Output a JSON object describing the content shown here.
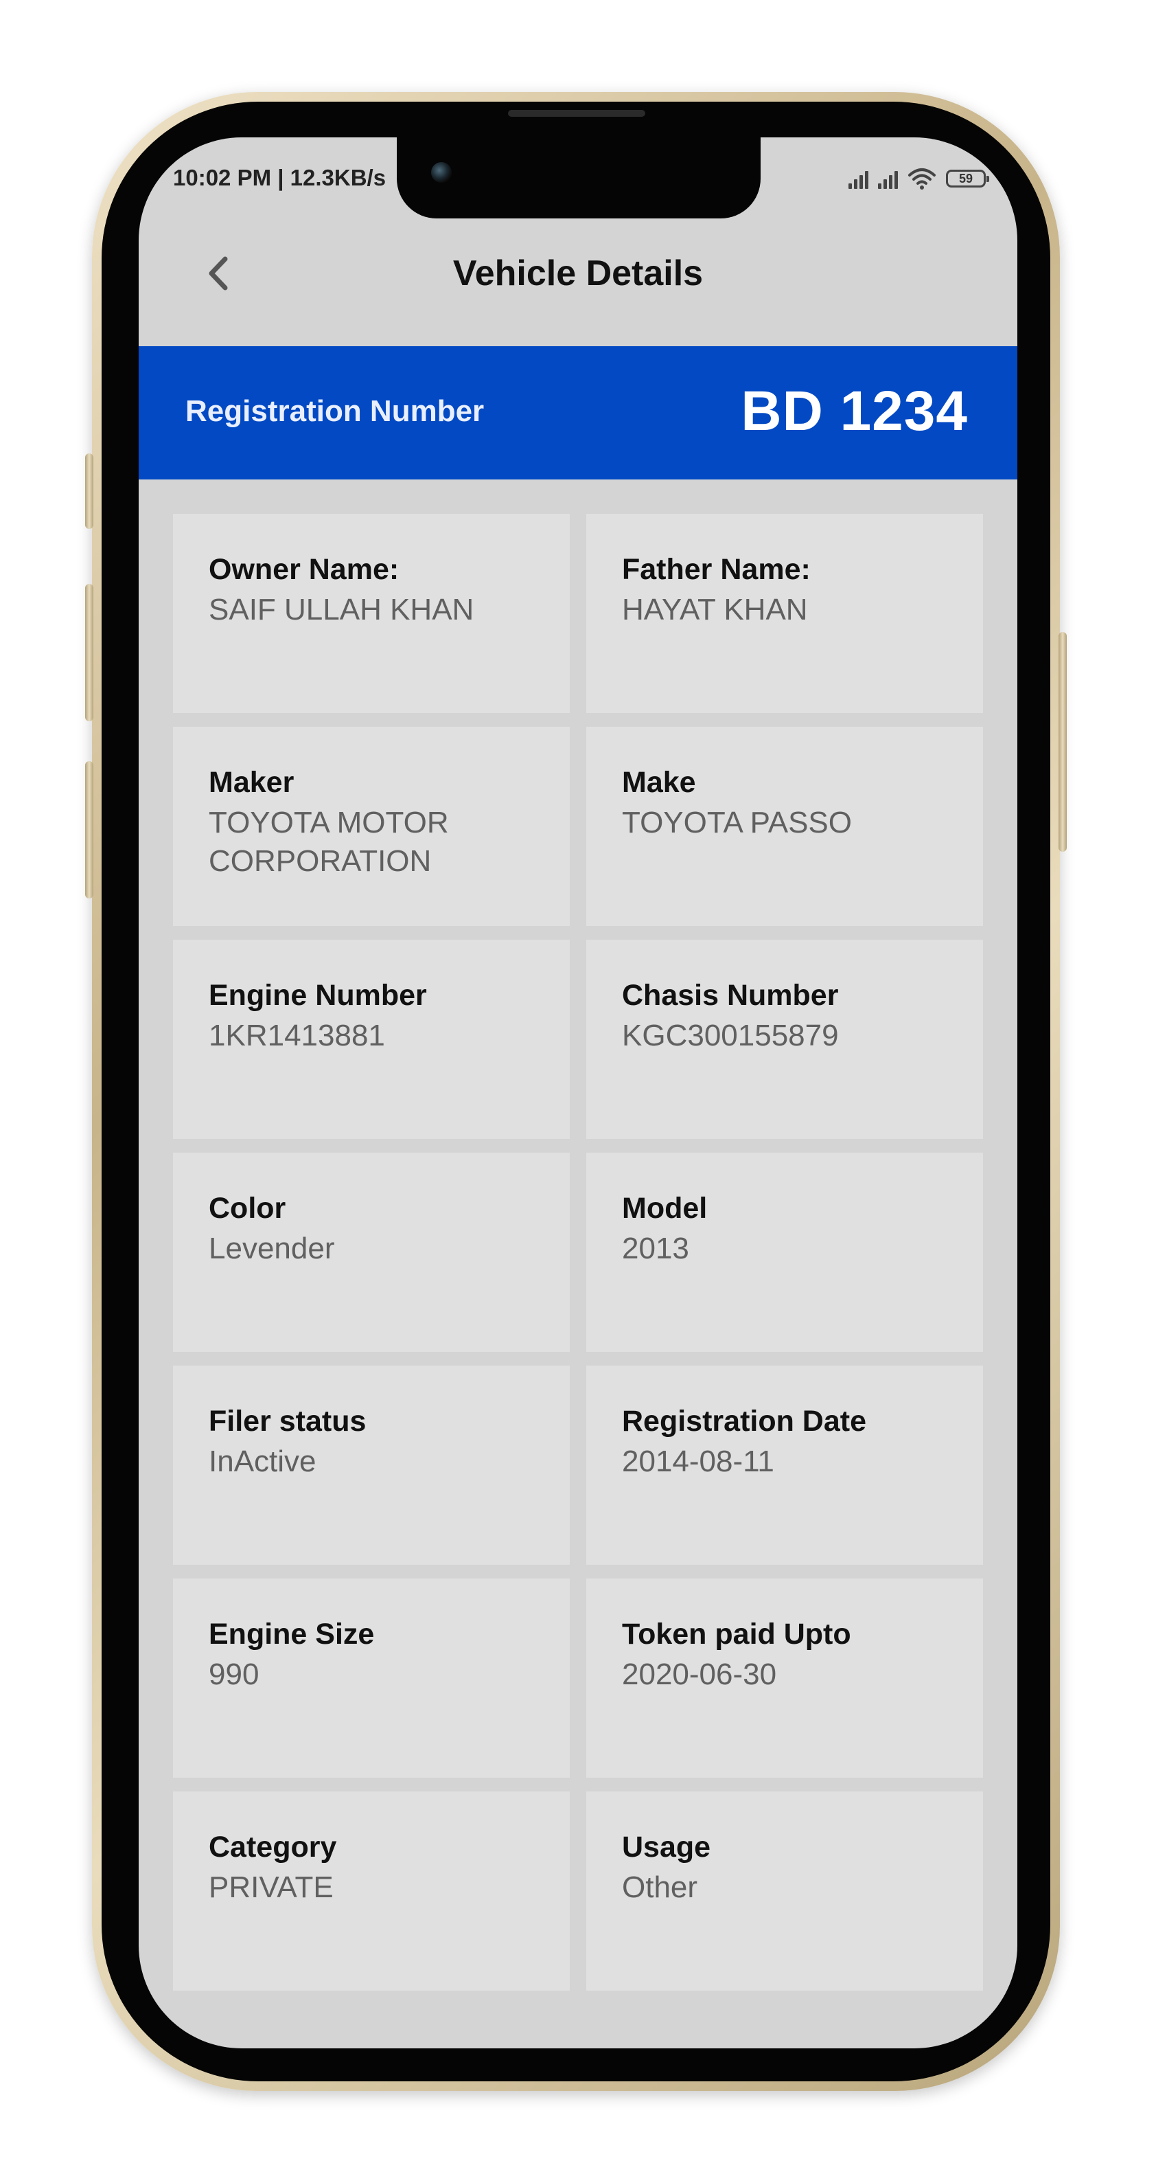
{
  "status_bar": {
    "time_text": "10:02 PM | 12.3KB/s",
    "battery_level": "59",
    "icons": [
      "signal-icon",
      "signal-icon",
      "wifi-icon",
      "battery-icon"
    ]
  },
  "header": {
    "title": "Vehicle Details",
    "back_icon": "chevron-left-icon"
  },
  "registration": {
    "label": "Registration Number",
    "value": "BD 1234",
    "color": "#0249c3"
  },
  "details": [
    {
      "label": "Owner Name:",
      "value": "SAIF ULLAH KHAN"
    },
    {
      "label": "Father Name:",
      "value": "HAYAT KHAN"
    },
    {
      "label": "Maker",
      "value": "TOYOTA MOTOR CORPORATION"
    },
    {
      "label": "Make",
      "value": "TOYOTA PASSO"
    },
    {
      "label": "Engine Number",
      "value": "1KR1413881"
    },
    {
      "label": "Chasis Number",
      "value": "KGC300155879"
    },
    {
      "label": "Color",
      "value": "Levender"
    },
    {
      "label": "Model",
      "value": "2013"
    },
    {
      "label": "Filer status",
      "value": "InActive"
    },
    {
      "label": "Registration Date",
      "value": "2014-08-11"
    },
    {
      "label": "Engine Size",
      "value": "990"
    },
    {
      "label": "Token paid Upto",
      "value": "2020-06-30"
    },
    {
      "label": "Category",
      "value": "PRIVATE"
    },
    {
      "label": "Usage",
      "value": "Other"
    }
  ]
}
